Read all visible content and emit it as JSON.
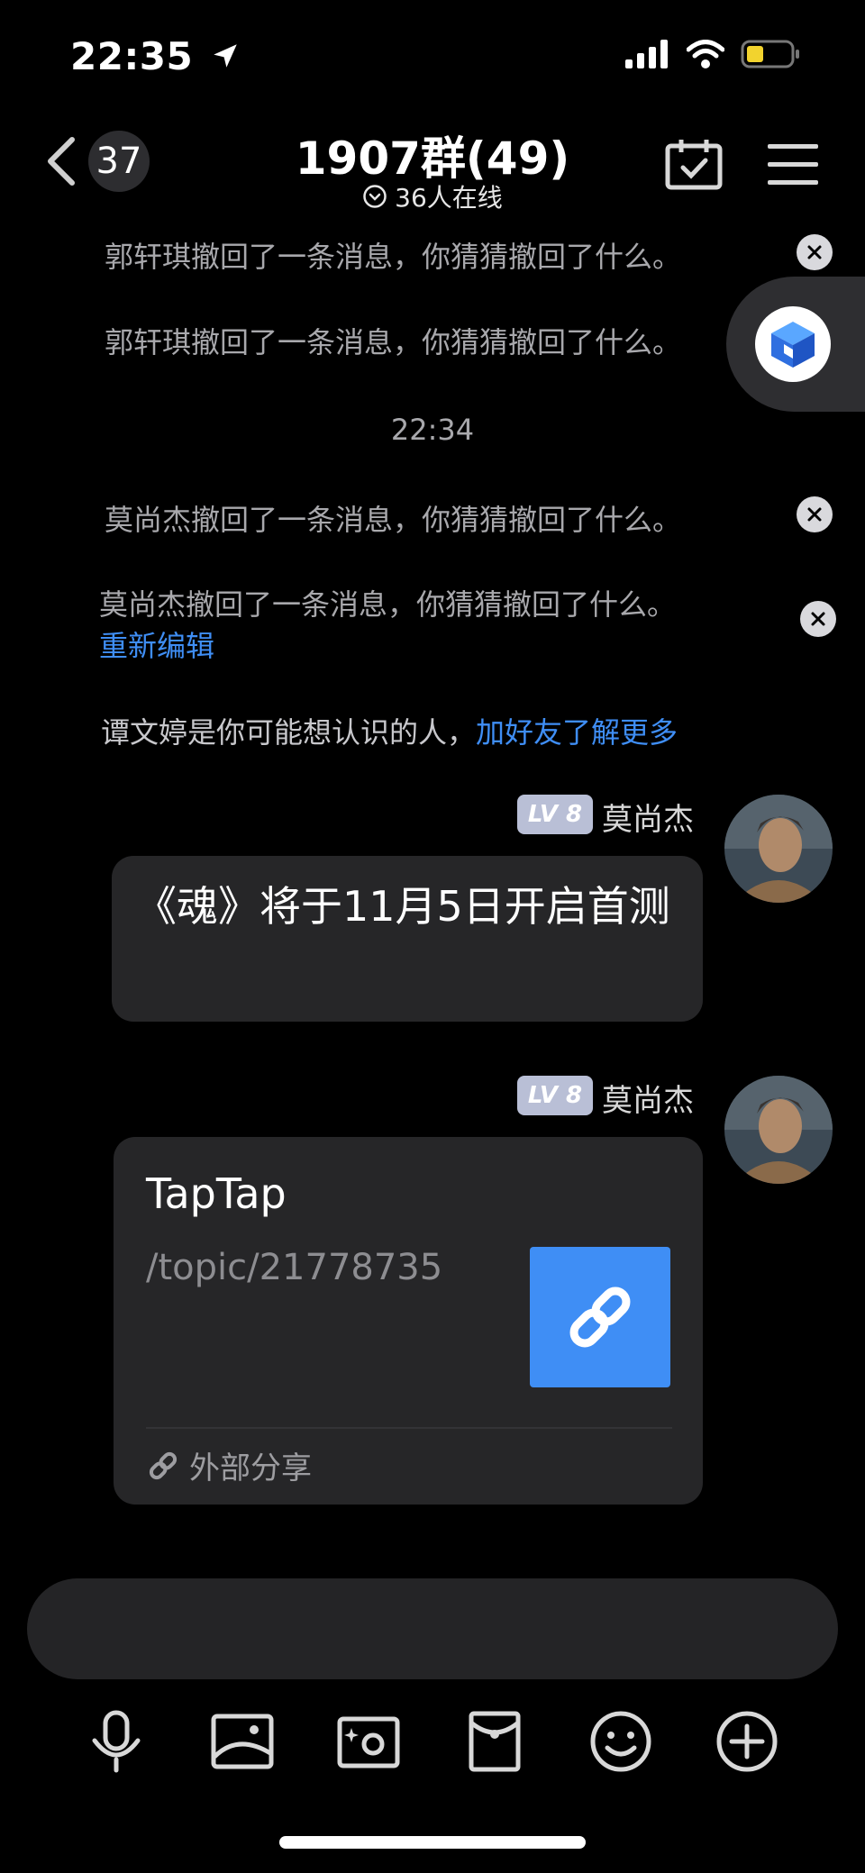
{
  "status_bar": {
    "time": "22:35"
  },
  "header": {
    "unread_count": "37",
    "title": "1907群(49)",
    "online_text": "36人在线"
  },
  "notices": [
    {
      "text": "郭轩琪撤回了一条消息，你猜猜撤回了什么。"
    },
    {
      "text": "郭轩琪撤回了一条消息，你猜猜撤回了什么。"
    },
    {
      "text": "莫尚杰撤回了一条消息，你猜猜撤回了什么。"
    },
    {
      "text": "莫尚杰撤回了一条消息，你猜猜撤回了什么。",
      "action": "重新编辑"
    }
  ],
  "timestamp": "22:34",
  "suggestion": {
    "text": "谭文婷是你可能想认识的人，",
    "link": "加好友了解更多"
  },
  "messages": [
    {
      "level": "LV 8",
      "sender": "莫尚杰",
      "text": "《魂》将于11月5日开启首测"
    },
    {
      "level": "LV 8",
      "sender": "莫尚杰",
      "card": {
        "title": "TapTap",
        "path": "/topic/21778735",
        "footer": "外部分享"
      }
    }
  ],
  "input": {
    "placeholder": ""
  },
  "colors": {
    "accent": "#3f8ef5",
    "bubble": "#262628",
    "background": "#000000",
    "level_badge": "#b9bfd6"
  },
  "icons": {
    "toolbar": [
      "microphone-icon",
      "image-icon",
      "camera-icon",
      "red-packet-icon",
      "emoji-icon",
      "plus-icon"
    ]
  }
}
